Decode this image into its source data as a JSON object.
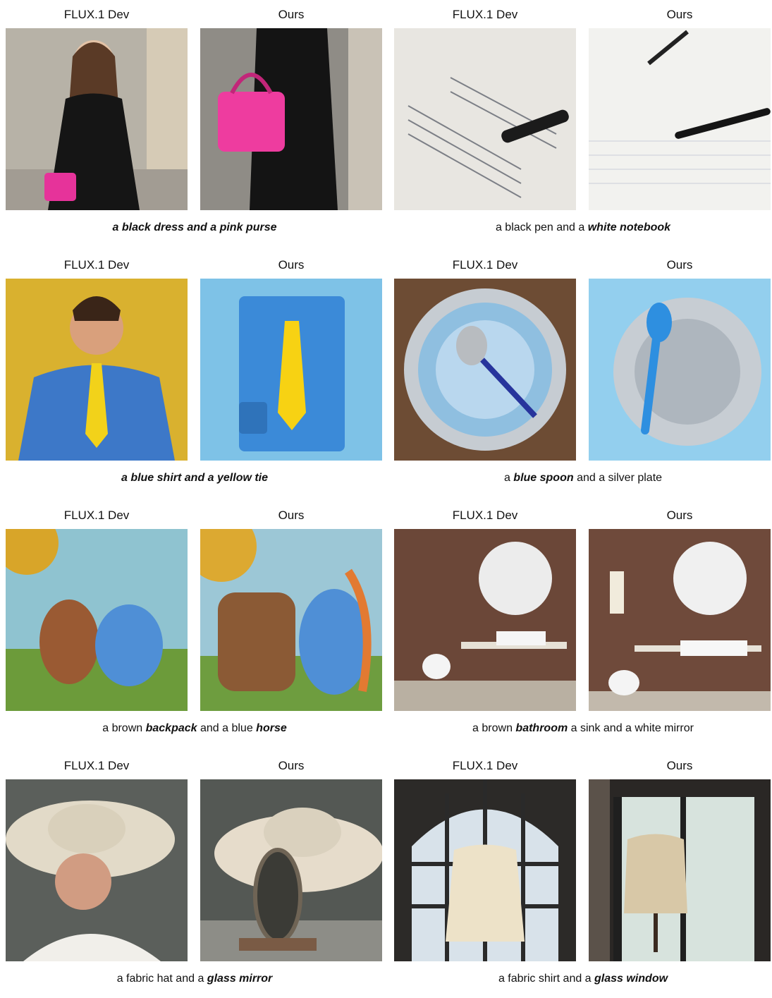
{
  "column_labels": {
    "left": "FLUX.1 Dev",
    "right": "Ours"
  },
  "pairs": [
    {
      "caption": [
        {
          "t": "a black dress and a pink purse",
          "b": true
        }
      ]
    },
    {
      "caption": [
        {
          "t": "a black pen and a ",
          "b": false
        },
        {
          "t": "white notebook",
          "b": true
        }
      ]
    },
    {
      "caption": [
        {
          "t": "a blue shirt and a yellow tie",
          "b": true
        }
      ]
    },
    {
      "caption": [
        {
          "t": "a ",
          "b": false
        },
        {
          "t": "blue spoon",
          "b": true
        },
        {
          "t": " and a silver plate",
          "b": false
        }
      ]
    },
    {
      "caption": [
        {
          "t": "a brown ",
          "b": false
        },
        {
          "t": "backpack",
          "b": true
        },
        {
          "t": " and a blue ",
          "b": false
        },
        {
          "t": "horse",
          "b": true
        }
      ]
    },
    {
      "caption": [
        {
          "t": "a brown ",
          "b": false
        },
        {
          "t": "bathroom",
          "b": true
        },
        {
          "t": " a sink and a white mirror",
          "b": false
        }
      ]
    },
    {
      "caption": [
        {
          "t": "a fabric hat and a ",
          "b": false
        },
        {
          "t": "glass mirror",
          "b": true
        }
      ]
    },
    {
      "caption": [
        {
          "t": "a fabric shirt and a ",
          "b": false
        },
        {
          "t": "glass window",
          "b": true
        }
      ]
    }
  ]
}
